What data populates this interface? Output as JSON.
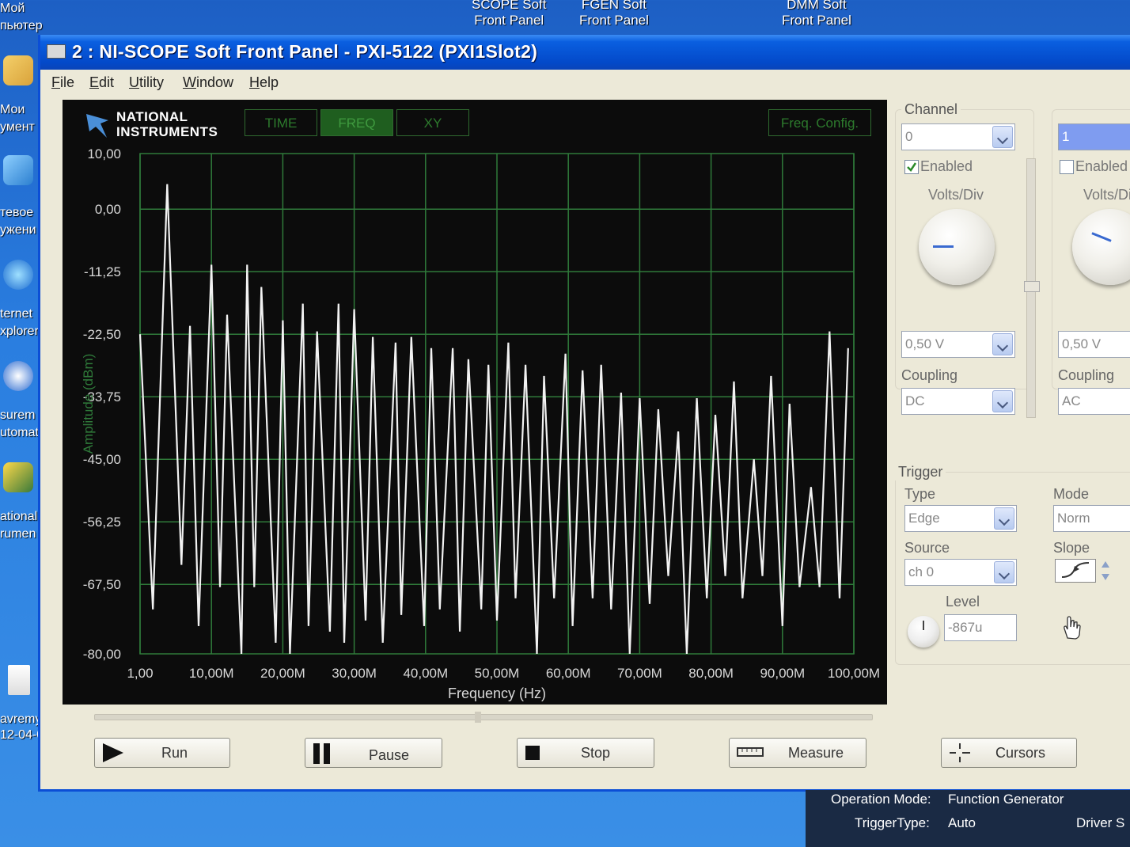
{
  "desktop": {
    "shortcuts_top": [
      {
        "line1": "SCOPE Soft",
        "line2": "Front Panel"
      },
      {
        "line1": "FGEN Soft",
        "line2": "Front Panel"
      },
      {
        "line1": "DMM Soft",
        "line2": "Front Panel"
      }
    ],
    "left_labels": [
      "Мой",
      "пьютер",
      "Мои",
      "умент",
      "тевое",
      "ужени",
      "ternet",
      "xplorer",
      "surem",
      "utomat",
      "ational",
      "rumen",
      "avremy",
      "12-04-0"
    ]
  },
  "window": {
    "title": "2 : NI-SCOPE Soft Front Panel - PXI-5122 (PXI1Slot2)",
    "menu": [
      "File",
      "Edit",
      "Utility",
      "Window",
      "Help"
    ]
  },
  "graph": {
    "logo_line1": "NATIONAL",
    "logo_line2": "INSTRUMENTS",
    "tabs": [
      {
        "label": "TIME",
        "active": false
      },
      {
        "label": "FREQ",
        "active": true
      },
      {
        "label": "XY",
        "active": false
      }
    ],
    "freq_config_label": "Freq. Config.",
    "colors": {
      "grid": "#2f7a3a",
      "trace": "#f2f2f2",
      "axis_text": "#d9d9d9",
      "background": "#0c0c0c"
    }
  },
  "chart_data": {
    "type": "line",
    "xlabel": "Frequency (Hz)",
    "ylabel": "Amplitude (dBm)",
    "x_ticks": [
      "1,00",
      "10,00M",
      "20,00M",
      "30,00M",
      "40,00M",
      "50,00M",
      "60,00M",
      "70,00M",
      "80,00M",
      "90,00M",
      "100,00M"
    ],
    "y_ticks": [
      "10,00",
      "0,00",
      "-11,25",
      "-22,50",
      "-33,75",
      "-45,00",
      "-56,25",
      "-67,50",
      "-80,00"
    ],
    "xlim": [
      1,
      100000000
    ],
    "ylim": [
      -80,
      10
    ],
    "grid": true,
    "series": [
      {
        "x_mhz": [
          0,
          1.8,
          3.8,
          5.8,
          7.0,
          8.2,
          10.0,
          11.2,
          12.2,
          14.2,
          15.0,
          16.0,
          17.0,
          19.0,
          20.0,
          21.0,
          22.8,
          23.6,
          24.8,
          26.6,
          27.8,
          28.6,
          30.0,
          31.6,
          32.6,
          34.0,
          35.8,
          36.6,
          38.0,
          39.8,
          40.8,
          42.0,
          43.8,
          44.8,
          46.0,
          47.8,
          48.8,
          50.0,
          51.6,
          52.6,
          54.0,
          55.6,
          56.6,
          58.0,
          59.6,
          60.6,
          62.0,
          63.4,
          64.6,
          66.0,
          67.4,
          68.6,
          70.0,
          71.4,
          72.6,
          74.0,
          75.4,
          76.6,
          78.0,
          79.4,
          80.6,
          82.0,
          83.2,
          84.4,
          86.0,
          87.2,
          88.4,
          90.0,
          91.0,
          92.4,
          94.0,
          95.2,
          96.6,
          98.0,
          99.2
        ],
        "y": [
          -22.5,
          -72.0,
          4.5,
          -64.0,
          -21.0,
          -75.0,
          -10.0,
          -68.0,
          -19.0,
          -80.0,
          -10.0,
          -68.0,
          -14.0,
          -78.0,
          -20.0,
          -80.0,
          -17.0,
          -75.0,
          -22.0,
          -76.0,
          -17.0,
          -78.0,
          -18.0,
          -74.0,
          -23.0,
          -78.0,
          -24.0,
          -73.0,
          -23.0,
          -75.0,
          -25.0,
          -72.0,
          -25.0,
          -76.0,
          -27.0,
          -72.0,
          -28.0,
          -74.0,
          -24.0,
          -70.0,
          -28.0,
          -80.0,
          -30.0,
          -70.0,
          -26.0,
          -75.0,
          -29.0,
          -70.0,
          -28.0,
          -72.0,
          -33.0,
          -80.0,
          -34.0,
          -71.0,
          -36.0,
          -66.0,
          -40.0,
          -80.0,
          -34.0,
          -70.0,
          -37.0,
          -66.0,
          -31.0,
          -70.0,
          -45.0,
          -66.0,
          -30.0,
          -75.0,
          -35.0,
          -68.0,
          -50.0,
          -68.0,
          -22.0,
          -70.0,
          -25.0,
          -72.0,
          -70.0
        ]
      }
    ]
  },
  "buttons": [
    {
      "label": "Run",
      "icon": "play-icon"
    },
    {
      "label": "Pause",
      "icon": "pause-icon"
    },
    {
      "label": "Stop",
      "icon": "stop-icon"
    },
    {
      "label": "Measure",
      "icon": "ruler-icon"
    },
    {
      "label": "Cursors",
      "icon": "crosshair-icon"
    }
  ],
  "channel": {
    "group_label": "Channel",
    "ch0": {
      "value": "0",
      "enabled_label": "Enabled",
      "enabled": true,
      "volts_div_label": "Volts/Div",
      "volts_value": "0,50 V",
      "coupling_label": "Coupling",
      "coupling_value": "DC"
    },
    "ch1": {
      "value": "1",
      "enabled_label": "Enabled",
      "enabled": false,
      "volts_div_label": "Volts/Di",
      "volts_value": "0,50 V",
      "coupling_label": "Coupling",
      "coupling_value": "AC"
    }
  },
  "trigger": {
    "group_label": "Trigger",
    "type_label": "Type",
    "type_value": "Edge",
    "mode_label": "Mode",
    "mode_value": "Norm",
    "source_label": "Source",
    "source_value": "ch 0",
    "slope_label": "Slope",
    "level_label": "Level",
    "level_value": "-867u"
  },
  "status": {
    "op_mode_label": "Operation Mode:",
    "op_mode_value": "Function Generator",
    "trigger_type_label": "TriggerType:",
    "trigger_type_value": "Auto",
    "driver_label": "Driver S"
  }
}
